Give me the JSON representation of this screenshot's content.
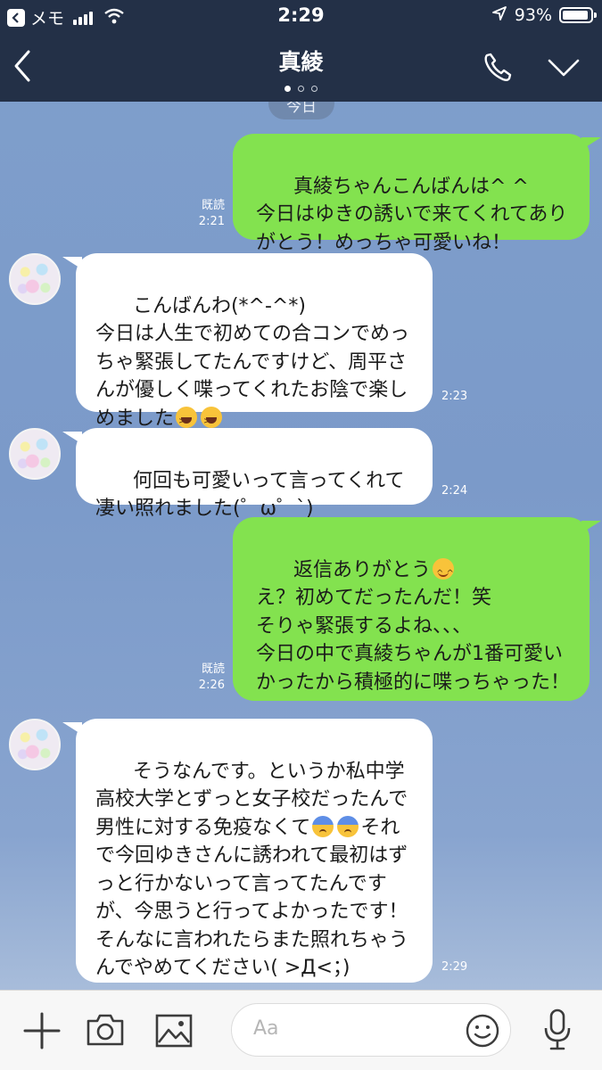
{
  "status_bar": {
    "back_app": "メモ",
    "time": "2:29",
    "battery_percent": "93%",
    "icons": [
      "back-to-app-icon",
      "signal-icon",
      "wifi-icon",
      "location-arrow-icon",
      "battery-icon"
    ]
  },
  "header": {
    "title": "真綾",
    "page_dots": 3,
    "active_dot": 0,
    "icons": [
      "back-chevron-icon",
      "phone-icon",
      "chevron-down-icon"
    ]
  },
  "chat": {
    "date_chip": "今日",
    "messages": [
      {
        "side": "mine",
        "text": "真綾ちゃんこんばんは^ ^\n今日はゆきの誘いで来てくれてありがとう！めっちゃ可愛いね！",
        "read": "既読",
        "time": "2:21"
      },
      {
        "side": "theirs",
        "text": "こんばんわ(*^-^*)\n今日は人生で初めての合コンでめっちゃ緊張してたんですけど、周平さんが優しく喋ってくれたお陰で楽しめました",
        "emoji": [
          "laughing-emoji",
          "laughing-emoji"
        ],
        "time": "2:23"
      },
      {
        "side": "theirs",
        "text": "何回も可愛いって言ってくれて凄い照れました(゜ω゜`)",
        "time": "2:24"
      },
      {
        "side": "mine",
        "text": "返信ありがとう",
        "emoji": [
          "smiling-emoji"
        ],
        "text_after": "え？初めてだったんだ！笑\nそりゃ緊張するよね、、、\n今日の中で真綾ちゃんが1番可愛いかったから積極的に喋っちゃった！",
        "read": "既読",
        "time": "2:26"
      },
      {
        "side": "theirs",
        "text_before": "そうなんです。というか私中学高校大学とずっと女子校だったんで男性に対する免疫なくて",
        "emoji": [
          "anxious-sweat-emoji",
          "anxious-sweat-emoji"
        ],
        "text": "それで今回ゆきさんに誘われて最初はずっと行かないって言ってたんですが、今思うと行ってよかったです！\nそんなに言われたらまた照れちゃうんでやめてください( >Д<；)",
        "time": "2:29"
      }
    ]
  },
  "input_bar": {
    "placeholder": "Aa",
    "icons": [
      "plus-icon",
      "camera-icon",
      "image-icon",
      "emoji-icon",
      "microphone-icon"
    ]
  },
  "colors": {
    "header_bg": "#233047",
    "my_bubble": "#83e24f",
    "their_bubble": "#ffffff",
    "chat_bg": "#7f9fcc"
  }
}
